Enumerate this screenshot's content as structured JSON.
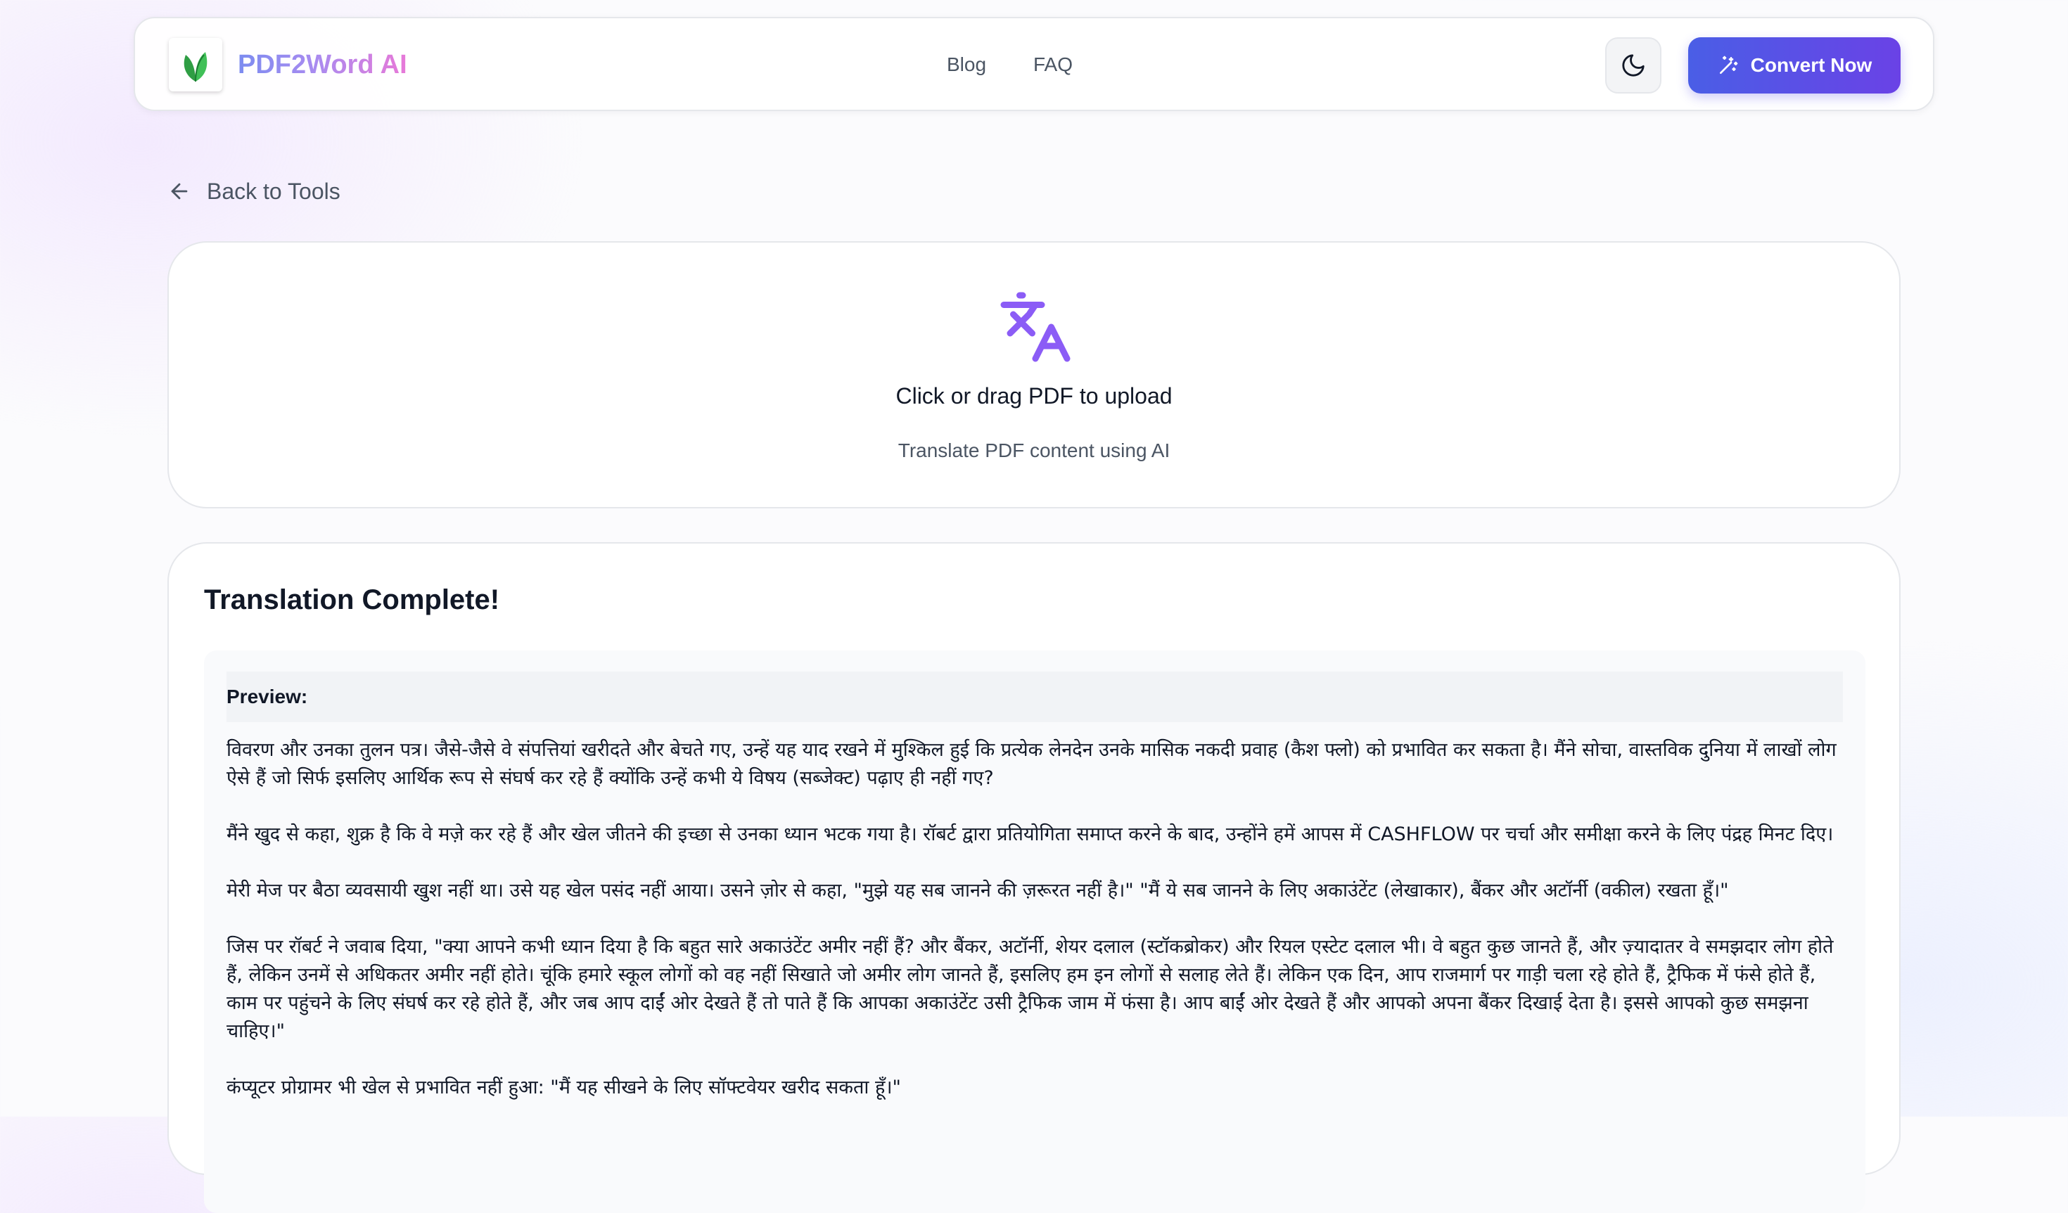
{
  "header": {
    "logo_text": "PDF2Word AI",
    "logo_icon": "leaf-icon",
    "nav": [
      {
        "label": "Blog"
      },
      {
        "label": "FAQ"
      }
    ],
    "theme_toggle_icon": "moon-icon",
    "convert_button": {
      "label": "Convert Now",
      "icon": "magic-wand-icon"
    }
  },
  "back_link": {
    "label": "Back to Tools",
    "icon": "arrow-left-icon"
  },
  "upload": {
    "icon": "translate-icon",
    "title": "Click or drag PDF to upload",
    "subtitle": "Translate PDF content using AI"
  },
  "result": {
    "title": "Translation Complete!",
    "preview_label": "Preview:",
    "paragraphs": [
      "विवरण और उनका तुलन पत्र। जैसे-जैसे वे संपत्तियां खरीदते और बेचते गए, उन्हें यह याद रखने में मुश्किल हुई कि प्रत्येक लेनदेन उनके मासिक नकदी प्रवाह (कैश फ्लो) को प्रभावित कर सकता है। मैंने सोचा, वास्तविक दुनिया में लाखों लोग ऐसे हैं जो सिर्फ इसलिए आर्थिक रूप से संघर्ष कर रहे हैं क्योंकि उन्हें कभी ये विषय (सब्जेक्ट) पढ़ाए ही नहीं गए?",
      "मैंने खुद से कहा, शुक्र है कि वे मज़े कर रहे हैं और खेल जीतने की इच्छा से उनका ध्यान भटक गया है। रॉबर्ट द्वारा प्रतियोगिता समाप्त करने के बाद, उन्होंने हमें आपस में CASHFLOW पर चर्चा और समीक्षा करने के लिए पंद्रह मिनट दिए।",
      "मेरी मेज पर बैठा व्यवसायी खुश नहीं था। उसे यह खेल पसंद नहीं आया। उसने ज़ोर से कहा, \"मुझे यह सब जानने की ज़रूरत नहीं है।\" \"मैं ये सब जानने के लिए अकाउंटेंट (लेखाकार), बैंकर और अटॉर्नी (वकील) रखता हूँ।\"",
      "जिस पर रॉबर्ट ने जवाब दिया, \"क्या आपने कभी ध्यान दिया है कि बहुत सारे अकाउंटेंट अमीर नहीं हैं? और बैंकर, अटॉर्नी, शेयर दलाल (स्टॉकब्रोकर) और रियल एस्टेट दलाल भी। वे बहुत कुछ जानते हैं, और ज़्यादातर वे समझदार लोग होते हैं, लेकिन उनमें से अधिकतर अमीर नहीं होते। चूंकि हमारे स्कूल लोगों को वह नहीं सिखाते जो अमीर लोग जानते हैं, इसलिए हम इन लोगों से सलाह लेते हैं। लेकिन एक दिन, आप राजमार्ग पर गाड़ी चला रहे होते हैं, ट्रैफिक में फंसे होते हैं, काम पर पहुंचने के लिए संघर्ष कर रहे होते हैं, और जब आप दाईं ओर देखते हैं तो पाते हैं कि आपका अकाउंटेंट उसी ट्रैफिक जाम में फंसा है। आप बाईं ओर देखते हैं और आपको अपना बैंकर दिखाई देता है। इससे आपको कुछ समझना चाहिए।\"",
      "कंप्यूटर प्रोग्रामर भी खेल से प्रभावित नहीं हुआ: \"मैं यह सीखने के लिए सॉफ्टवेयर खरीद सकता हूँ।\""
    ]
  },
  "colors": {
    "accent_start": "#4a5ee6",
    "accent_end": "#6a42e6",
    "translate_icon": "#8b5cf6",
    "leaf": "#22a645"
  }
}
